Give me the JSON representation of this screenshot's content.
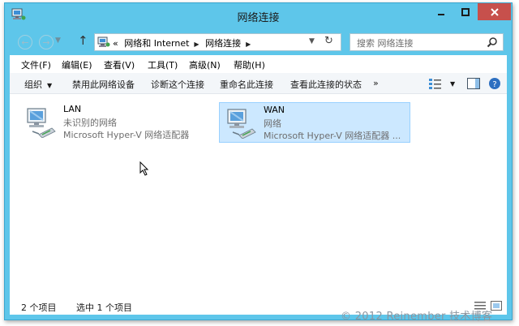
{
  "window": {
    "title": "网络连接",
    "colors": {
      "frame": "#5ec6ea",
      "close": "#c7504c",
      "selected_bg": "#cce8ff",
      "selected_border": "#99d1ff"
    }
  },
  "address": {
    "prefix": "«",
    "crumbs": [
      "网络和 Internet",
      "网络连接"
    ],
    "search_placeholder": "搜索 网络连接"
  },
  "menu": [
    {
      "label": "文件(F)"
    },
    {
      "label": "编辑(E)"
    },
    {
      "label": "查看(V)"
    },
    {
      "label": "工具(T)"
    },
    {
      "label": "高级(N)"
    },
    {
      "label": "帮助(H)"
    }
  ],
  "commands": {
    "organize": "组织",
    "items": [
      "禁用此网络设备",
      "诊断这个连接",
      "重命名此连接",
      "查看此连接的状态"
    ],
    "more": "»"
  },
  "connections": [
    {
      "name": "LAN",
      "status": "未识别的网络",
      "adapter": "Microsoft Hyper-V 网络适配器",
      "selected": false
    },
    {
      "name": "WAN",
      "status": "网络",
      "adapter": "Microsoft Hyper-V 网络适配器 ...",
      "selected": true
    }
  ],
  "status": {
    "count": "2 个项目",
    "selection": "选中 1 个项目"
  },
  "watermark": "© 2012 Reinember 技术博客"
}
